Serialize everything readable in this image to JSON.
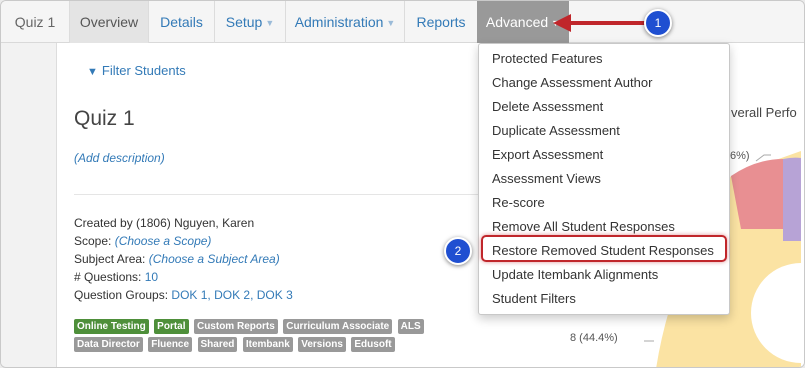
{
  "nav": {
    "quiz": "Quiz 1",
    "overview": "Overview",
    "details": "Details",
    "setup": "Setup",
    "administration": "Administration",
    "reports": "Reports",
    "advanced": "Advanced"
  },
  "filter_label": "Filter Students",
  "quiz_title": "Quiz 1",
  "add_description": "(Add description)",
  "info": {
    "created_by_label": "Created by",
    "created_by_value": "(1806) Nguyen, Karen",
    "scope_label": "Scope:",
    "scope_value": "(Choose a Scope)",
    "subject_label": "Subject Area:",
    "subject_value": "(Choose a Subject Area)",
    "questions_label": "# Questions:",
    "questions_value": "10",
    "groups_label": "Question Groups:",
    "groups_value": "DOK 1, DOK 2, DOK 3"
  },
  "badges_row1": [
    {
      "label": "Online Testing",
      "style": "green"
    },
    {
      "label": "Portal",
      "style": "green"
    },
    {
      "label": "Custom Reports",
      "style": "gray"
    },
    {
      "label": "Curriculum Associate",
      "style": "gray"
    },
    {
      "label": "ALS",
      "style": "gray"
    }
  ],
  "badges_row2": [
    {
      "label": "Data Director",
      "style": "gray"
    },
    {
      "label": "Fluence",
      "style": "gray"
    },
    {
      "label": "Shared",
      "style": "gray"
    },
    {
      "label": "Itembank",
      "style": "gray"
    },
    {
      "label": "Versions",
      "style": "gray"
    },
    {
      "label": "Edusoft",
      "style": "gray"
    }
  ],
  "chart": {
    "title_fragment": "verall Perfo",
    "label_top": "6%)",
    "label_bottom": "8 (44.4%)"
  },
  "dropdown_items": [
    "Protected Features",
    "Change Assessment Author",
    "Delete Assessment",
    "Duplicate Assessment",
    "Export Assessment",
    "Assessment Views",
    "Re-score",
    "Remove All Student Responses",
    "Restore Removed Student Responses",
    "Update Itembank Alignments",
    "Student Filters"
  ],
  "callouts": {
    "one": "1",
    "two": "2"
  },
  "colors": {
    "link": "#337ab7",
    "advanced_bg": "#999999",
    "callout": "#1f4fd1",
    "highlight": "#c0262b",
    "badge_green": "#4e8f3a",
    "badge_gray": "#999999"
  }
}
